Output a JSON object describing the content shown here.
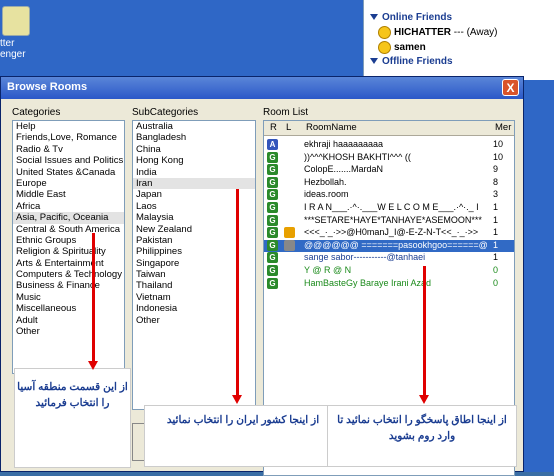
{
  "desktop": {
    "icon_label_1": "tter",
    "icon_label_2": "enger"
  },
  "messenger": {
    "online_header": "Online Friends",
    "friend_1_name": "HICHATTER",
    "friend_1_status": " --- (Away)",
    "friend_2_name": "samen",
    "offline_header": "Offline Friends"
  },
  "window": {
    "title": "Browse Rooms",
    "close": "X"
  },
  "labels": {
    "categories": "Categories",
    "subcategories": "SubCategories",
    "room_list": "Room List"
  },
  "categories": [
    "Help",
    "Friends,Love, Romance",
    "Radio & Tv",
    "Social Issues and Politics",
    "United States &Canada",
    "Europe",
    "Middle East",
    "Africa",
    "Asia, Pacific, Oceania",
    "Central & South America",
    "Ethnic Groups",
    "Religion & Spirituality",
    "Arts & Entertainment",
    "Computers & Technology",
    "Business & Finance",
    "Music",
    "Miscellaneous",
    "Adult",
    "Other"
  ],
  "subcategories": [
    "Australia",
    "Bangladesh",
    "China",
    "Hong Kong",
    "India",
    "Iran",
    "Japan",
    "Laos",
    "Malaysia",
    "New Zealand",
    "Pakistan",
    "Philippines",
    "Singapore",
    "Taiwan",
    "Thailand",
    "Vietnam",
    "Indonesia",
    "Other"
  ],
  "room_table": {
    "headers": {
      "r": "R",
      "l": "L",
      "name": "RoomName",
      "members": "Mer"
    },
    "rows": [
      {
        "icon": "A",
        "name": "ekhraji haaaaaaaaa",
        "count": "10"
      },
      {
        "icon": "G",
        "name": "))^^^KHOSH BAKHTI^^^ ((",
        "count": "10"
      },
      {
        "icon": "G",
        "name": "ColopE.......MardaN",
        "count": "9"
      },
      {
        "icon": "G",
        "name": "Hezbollah.",
        "count": "8"
      },
      {
        "icon": "G",
        "name": "ideas.room",
        "count": "3"
      },
      {
        "icon": "G",
        "name": "I R A N___.·^·.___W E L C O M E___.·^·._ I",
        "count": "1"
      },
      {
        "icon": "G",
        "name": "***SETARE*HAYE*TANHAYE*ASEMOON***",
        "count": "1"
      },
      {
        "icon": "G",
        "name": "<<<_·_·>>@H0manJ_I@-E-Z-N-T<<_·_·>>",
        "count": "1"
      },
      {
        "icon": "G",
        "name": "@@@@@@ =======pasookhgoo======@",
        "count": "1"
      },
      {
        "icon": "G",
        "name": "sange sabor-----------@tanhaei",
        "count": "1"
      },
      {
        "icon": "G",
        "name": "Y @ R @ N",
        "count": "0"
      },
      {
        "icon": "G",
        "name": "HamBasteGy   Baraye  Irani  Azad",
        "count": "0"
      }
    ]
  },
  "callouts": {
    "categories_note": "از این قسمت منطقه آسیا را انتخاب فرمائید",
    "country_note": "از اینجا کشور ایران را انتخاب نمائید",
    "room_note": "از اینجا اطاق پاسخگو را انتخاب نمائید تا وارد روم بشوید"
  }
}
